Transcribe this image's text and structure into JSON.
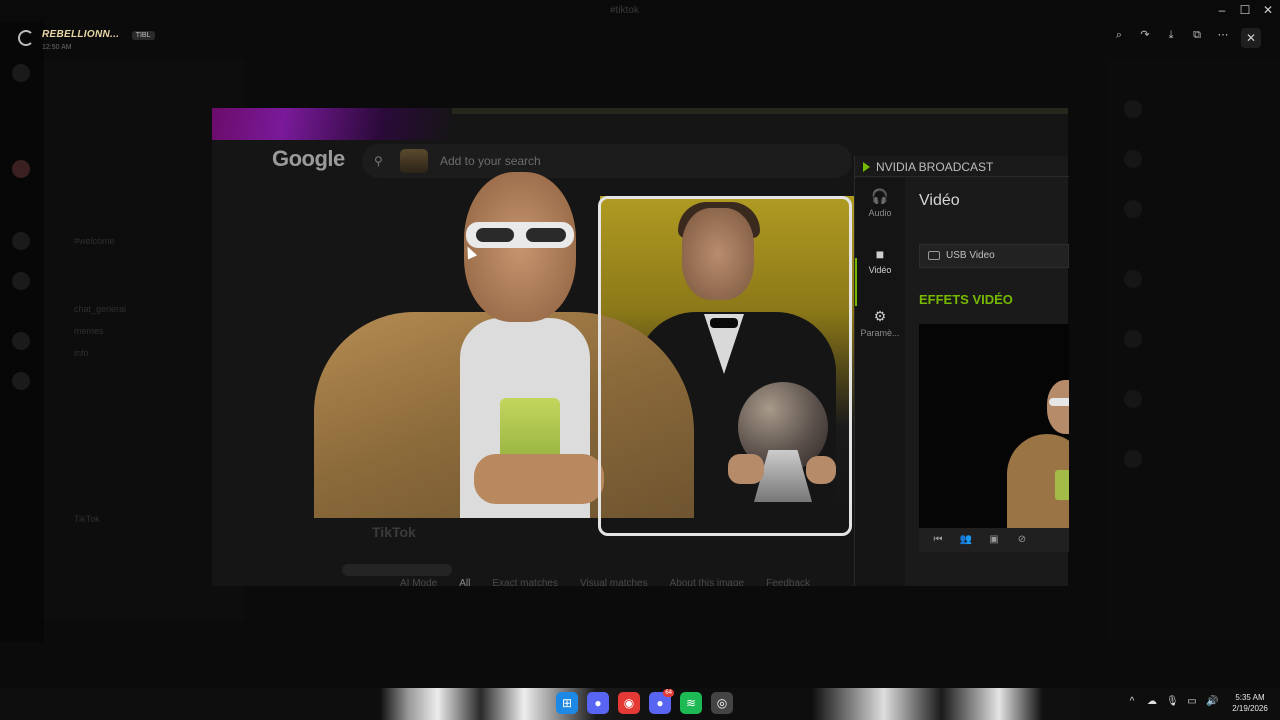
{
  "background_app": {
    "window_title": "#tiktok",
    "profile_name": "REBELLIONN...",
    "profile_tag": "TIBL",
    "profile_time": "12:50 AM",
    "channels": [
      "#welcome",
      "chat_general",
      "memes",
      "info",
      "TikTok"
    ]
  },
  "lens": {
    "logo": "Google",
    "search_placeholder": "Add to your search",
    "result_site": "TikTok",
    "tabs": [
      "AI Mode",
      "All",
      "Exact matches",
      "Visual matches",
      "About this image",
      "Feedback"
    ],
    "active_tab": "All"
  },
  "nvidia": {
    "app_title": "NVIDIA BROADCAST",
    "nav": [
      {
        "label": "Audio",
        "icon": "headphones-icon"
      },
      {
        "label": "Vidéo",
        "icon": "video-camera-icon"
      },
      {
        "label": "Paramè...",
        "icon": "gear-icon"
      }
    ],
    "section_title": "Vidéo",
    "device": "USB Video",
    "effects_heading": "EFFETS VIDÉO",
    "accent_color": "#76b900"
  },
  "taskbar": {
    "apps": [
      {
        "name": "windows-start-icon",
        "color": "#1e88e5"
      },
      {
        "name": "discord-icon",
        "color": "#5865f2"
      },
      {
        "name": "chrome-icon",
        "color": "#e53935"
      },
      {
        "name": "discord-canary-icon",
        "color": "#5865f2",
        "badge": "64"
      },
      {
        "name": "spotify-icon",
        "color": "#1db954"
      },
      {
        "name": "obs-icon",
        "color": "#444444"
      }
    ],
    "clock_time": "5:35 AM",
    "clock_date": "2/19/2026"
  }
}
